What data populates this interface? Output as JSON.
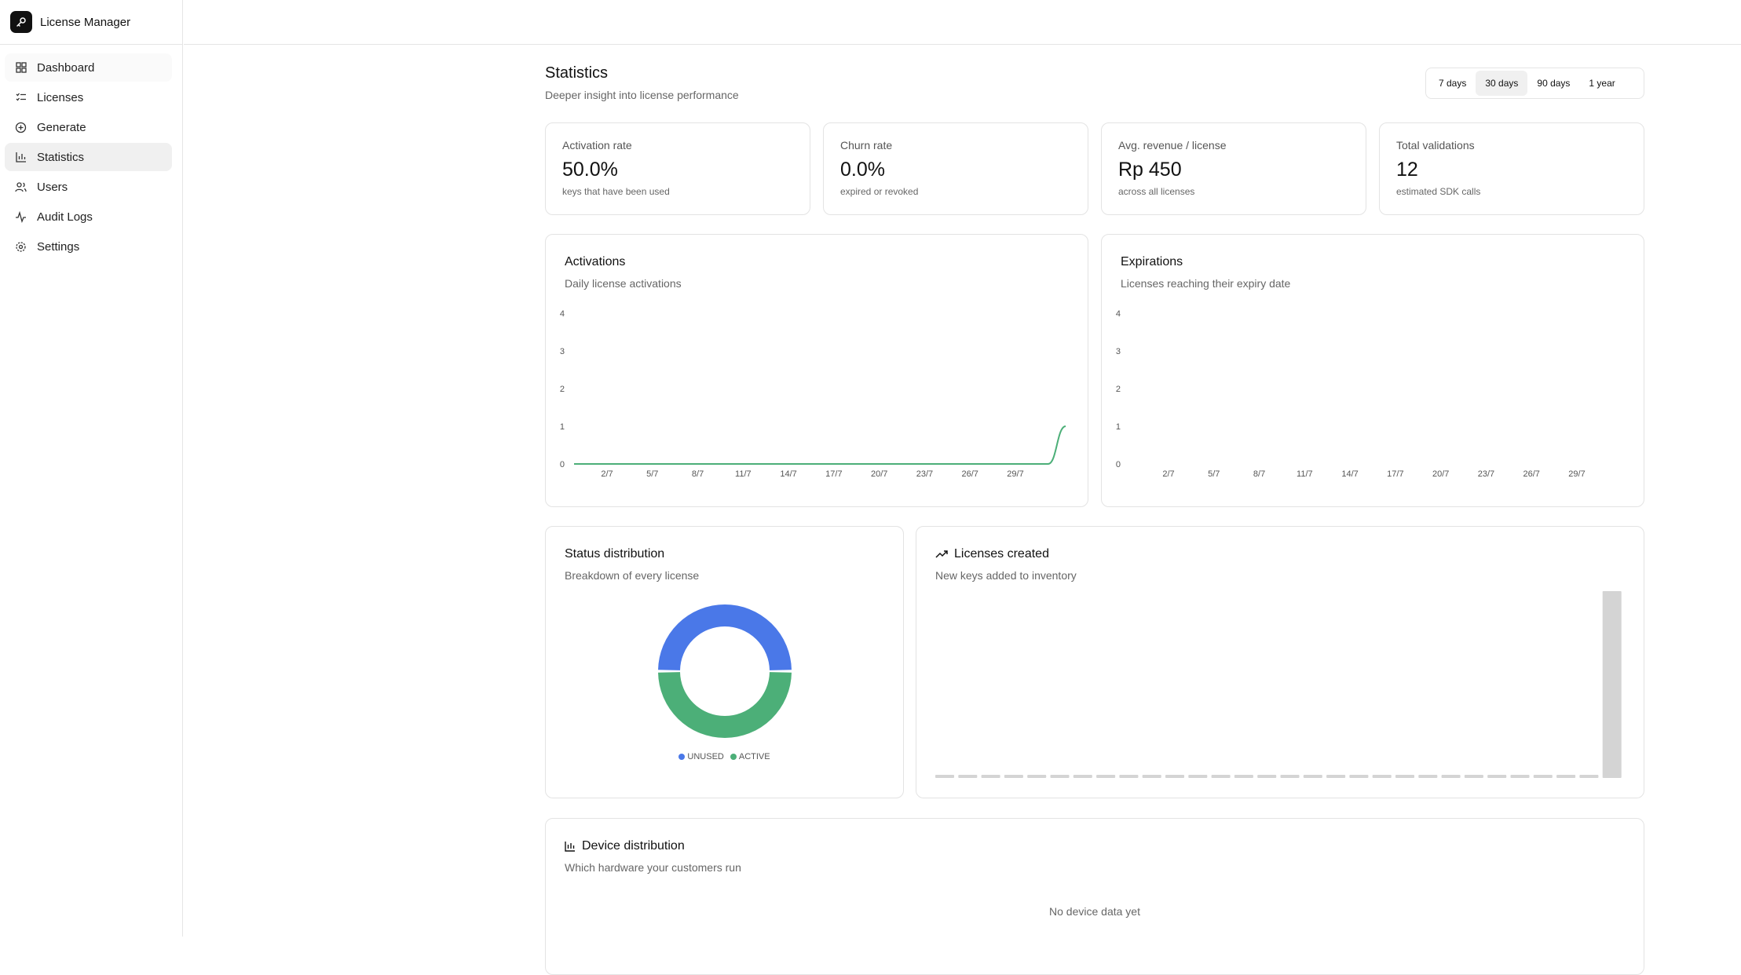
{
  "app": {
    "title": "License Manager"
  },
  "sidebar": {
    "items": [
      {
        "label": "Dashboard",
        "icon": "grid-icon"
      },
      {
        "label": "Licenses",
        "icon": "list-check-icon"
      },
      {
        "label": "Generate",
        "icon": "plus-circle-icon"
      },
      {
        "label": "Statistics",
        "icon": "bar-chart-icon",
        "active": true
      },
      {
        "label": "Users",
        "icon": "users-icon"
      },
      {
        "label": "Audit Logs",
        "icon": "activity-icon"
      },
      {
        "label": "Settings",
        "icon": "gear-icon"
      }
    ]
  },
  "page": {
    "title": "Statistics",
    "subtitle": "Deeper insight into license performance",
    "ranges": [
      "7 days",
      "30 days",
      "90 days",
      "1 year"
    ],
    "selected_range": "30 days"
  },
  "stats": [
    {
      "label": "Activation rate",
      "value": "50.0%",
      "sub": "keys that have been used"
    },
    {
      "label": "Churn rate",
      "value": "0.0%",
      "sub": "expired or revoked"
    },
    {
      "label": "Avg. revenue / license",
      "value": "Rp 450",
      "sub": "across all licenses"
    },
    {
      "label": "Total validations",
      "value": "12",
      "sub": "estimated SDK calls"
    }
  ],
  "activations": {
    "title": "Activations",
    "subtitle": "Daily license activations"
  },
  "expirations": {
    "title": "Expirations",
    "subtitle": "Licenses reaching their expiry date"
  },
  "status": {
    "title": "Status distribution",
    "subtitle": "Breakdown of every license"
  },
  "created": {
    "title": "Licenses created",
    "subtitle": "New keys added to inventory"
  },
  "devices": {
    "title": "Device distribution",
    "subtitle": "Which hardware your customers run",
    "empty": "No device data yet"
  },
  "colors": {
    "accent_green": "#4caf78",
    "accent_blue": "#4a78e8",
    "bar_gray": "#d4d4d4"
  },
  "chart_data": [
    {
      "type": "line",
      "title": "Activations",
      "y_ticks": [
        0,
        1,
        2,
        3,
        4
      ],
      "x_tick_labels": [
        "2/7",
        "5/7",
        "8/7",
        "11/7",
        "14/7",
        "17/7",
        "20/7",
        "23/7",
        "26/7",
        "29/7"
      ],
      "x": [
        "1/7",
        "2/7",
        "3/7",
        "4/7",
        "5/7",
        "6/7",
        "7/7",
        "8/7",
        "9/7",
        "10/7",
        "11/7",
        "12/7",
        "13/7",
        "14/7",
        "15/7",
        "16/7",
        "17/7",
        "18/7",
        "19/7",
        "20/7",
        "21/7",
        "22/7",
        "23/7",
        "24/7",
        "25/7",
        "26/7",
        "27/7",
        "28/7",
        "29/7"
      ],
      "values": [
        0,
        0,
        0,
        0,
        0,
        0,
        0,
        0,
        0,
        0,
        0,
        0,
        0,
        0,
        0,
        0,
        0,
        0,
        0,
        0,
        0,
        0,
        0,
        0,
        0,
        0,
        0,
        0,
        1
      ],
      "ylim": [
        0,
        4
      ],
      "color": "#4caf78"
    },
    {
      "type": "line",
      "title": "Expirations",
      "y_ticks": [
        0,
        1,
        2,
        3,
        4
      ],
      "x_tick_labels": [
        "2/7",
        "5/7",
        "8/7",
        "11/7",
        "14/7",
        "17/7",
        "20/7",
        "23/7",
        "26/7",
        "29/7"
      ],
      "values": [],
      "ylim": [
        0,
        4
      ]
    },
    {
      "type": "pie",
      "title": "Status distribution",
      "slices": [
        {
          "label": "UNUSED",
          "value": 1,
          "color": "#4a78e8"
        },
        {
          "label": "ACTIVE",
          "value": 1,
          "color": "#4caf78"
        }
      ]
    },
    {
      "type": "bar",
      "title": "Licenses created",
      "values": [
        0,
        0,
        0,
        0,
        0,
        0,
        0,
        0,
        0,
        0,
        0,
        0,
        0,
        0,
        0,
        0,
        0,
        0,
        0,
        0,
        0,
        0,
        0,
        0,
        0,
        0,
        0,
        0,
        0,
        2
      ],
      "color": "#d4d4d4"
    }
  ]
}
